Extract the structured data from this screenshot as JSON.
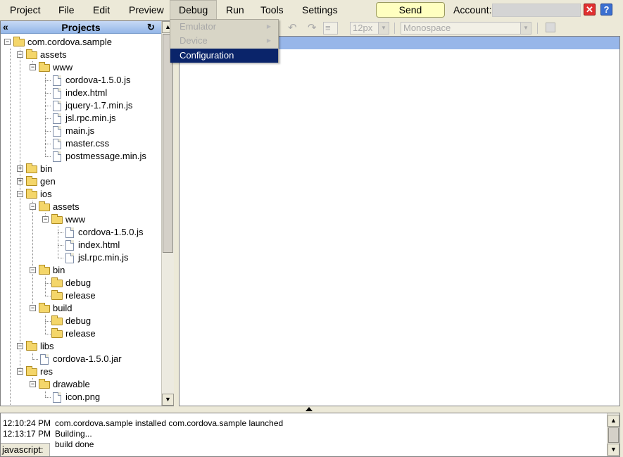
{
  "menu": {
    "items": [
      {
        "label": "Project"
      },
      {
        "label": "File"
      },
      {
        "label": "Edit"
      },
      {
        "label": "Preview"
      },
      {
        "label": "Debug"
      },
      {
        "label": "Run"
      },
      {
        "label": "Tools"
      },
      {
        "label": "Settings"
      }
    ],
    "feedback_label": "Send Feedback",
    "account_label": "Account:",
    "account_value": "",
    "close_glyph": "✕",
    "help_glyph": "?"
  },
  "debug_menu": {
    "items": [
      {
        "label": "Emulator",
        "state": "disabled",
        "has_submenu": true
      },
      {
        "label": "Device",
        "state": "disabled",
        "has_submenu": true
      },
      {
        "label": "Configuration",
        "state": "selected",
        "has_submenu": false
      }
    ]
  },
  "projects": {
    "title": "Projects",
    "collapse_glyph": "«",
    "refresh_glyph": "↻",
    "tree": [
      {
        "label": "com.cordova.sample",
        "type": "folder",
        "expanded": true
      },
      {
        "label": "assets",
        "type": "folder",
        "expanded": true
      },
      {
        "label": "www",
        "type": "folder",
        "expanded": true
      },
      {
        "label": "cordova-1.5.0.js",
        "type": "file"
      },
      {
        "label": "index.html",
        "type": "file"
      },
      {
        "label": "jquery-1.7.min.js",
        "type": "file"
      },
      {
        "label": "jsl.rpc.min.js",
        "type": "file"
      },
      {
        "label": "main.js",
        "type": "file"
      },
      {
        "label": "master.css",
        "type": "file"
      },
      {
        "label": "postmessage.min.js",
        "type": "file"
      },
      {
        "label": "bin",
        "type": "folder",
        "expanded": false
      },
      {
        "label": "gen",
        "type": "folder",
        "expanded": false
      },
      {
        "label": "ios",
        "type": "folder",
        "expanded": true
      },
      {
        "label": "assets",
        "type": "folder",
        "expanded": true
      },
      {
        "label": "www",
        "type": "folder",
        "expanded": true
      },
      {
        "label": "cordova-1.5.0.js",
        "type": "file"
      },
      {
        "label": "index.html",
        "type": "file"
      },
      {
        "label": "jsl.rpc.min.js",
        "type": "file"
      },
      {
        "label": "bin",
        "type": "folder",
        "expanded": true
      },
      {
        "label": "debug",
        "type": "folder"
      },
      {
        "label": "release",
        "type": "folder"
      },
      {
        "label": "build",
        "type": "folder",
        "expanded": true
      },
      {
        "label": "debug",
        "type": "folder"
      },
      {
        "label": "release",
        "type": "folder"
      },
      {
        "label": "libs",
        "type": "folder",
        "expanded": true
      },
      {
        "label": "cordova-1.5.0.jar",
        "type": "file"
      },
      {
        "label": "res",
        "type": "folder",
        "expanded": true
      },
      {
        "label": "drawable",
        "type": "folder",
        "expanded": true
      },
      {
        "label": "icon.png",
        "type": "file"
      }
    ]
  },
  "editor_toolbar": {
    "font_size": "12px",
    "font_family": "Monospace"
  },
  "console": {
    "lines": [
      {
        "time": "12:10:24 PM",
        "text": "com.cordova.sample installed com.cordova.sample launched"
      },
      {
        "time": "12:13:17 PM",
        "text": "Building..."
      },
      {
        "time": "",
        "text": "build done"
      }
    ],
    "js_label": "javascript:"
  },
  "colors": {
    "menu_bg": "#ece9d8",
    "selection": "#0a246a",
    "header_blue": "#97b6e9",
    "feedback_bg": "#ffffc0"
  }
}
